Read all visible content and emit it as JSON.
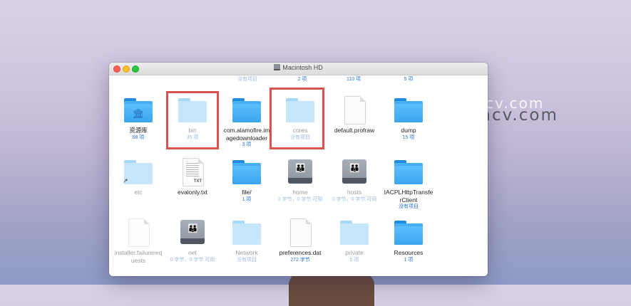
{
  "watermark": {
    "ghost": "cv.com",
    "main": "Macv.com"
  },
  "window": {
    "title": "Macintosh HD",
    "top_row_subs": [
      "没有项目",
      "2 项",
      "110 项",
      "5 项"
    ]
  },
  "items": [
    {
      "name": "资源库",
      "meta": "68 项",
      "icon": "folder-library-icon"
    },
    {
      "name": "bin",
      "meta": "35 项",
      "icon": "folder-icon",
      "dim": true,
      "highlight": true
    },
    {
      "name": "com.alamofire.imagedownloader",
      "line1": "com.alamofire.im",
      "line2": "agedownloader",
      "meta": "3 项",
      "icon": "folder-icon"
    },
    {
      "name": "cores",
      "meta": "没有项目",
      "icon": "folder-icon",
      "dim": true,
      "highlight": true
    },
    {
      "name": "default.profraw",
      "meta": "",
      "icon": "document-icon"
    },
    {
      "name": "dump",
      "meta": "15 项",
      "icon": "folder-icon"
    },
    {
      "name": "etc",
      "meta": "",
      "icon": "folder-alias-icon",
      "dim": true
    },
    {
      "name": "evalonly.txt",
      "meta": "",
      "icon": "text-document-icon"
    },
    {
      "name": "file/",
      "meta": "1 项",
      "icon": "folder-icon"
    },
    {
      "name": "home",
      "meta": "0 字节，0 字节 可用",
      "icon": "network-server-icon",
      "dim": true
    },
    {
      "name": "hosts",
      "meta": "0 字节，0 字节 可用",
      "icon": "network-server-icon",
      "dim": true
    },
    {
      "name": "IACPLHttpTransferClient",
      "line1": "IACPLHttpTransfe",
      "line2": "rClient",
      "meta": "没有项目",
      "icon": "folder-icon"
    },
    {
      "name": "installer.failurerequests",
      "line1": "installer.failurereq",
      "line2": "uests",
      "meta": "",
      "icon": "document-icon",
      "dim": true
    },
    {
      "name": "net",
      "meta": "0 字节，0 字节 可用",
      "icon": "network-server-icon",
      "dim": true
    },
    {
      "name": "Network",
      "meta": "没有项目",
      "icon": "folder-icon",
      "dim": true
    },
    {
      "name": "preferences.dat",
      "meta": "272 字节",
      "icon": "document-icon"
    },
    {
      "name": "private",
      "meta": "5 项",
      "icon": "folder-icon",
      "dim": true
    },
    {
      "name": "Resources",
      "meta": "1 项",
      "icon": "folder-icon"
    }
  ]
}
